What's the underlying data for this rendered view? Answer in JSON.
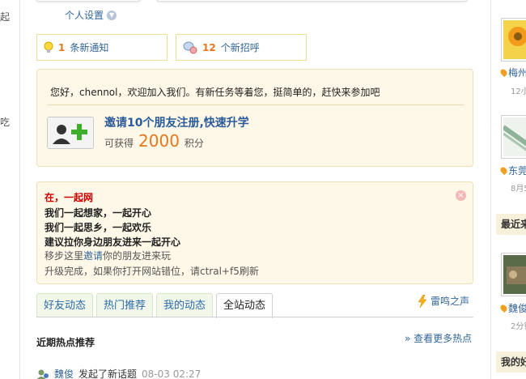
{
  "left_sidebar": {
    "chars": [
      "起",
      "吃"
    ]
  },
  "header": {
    "personal_settings": "个人设置"
  },
  "notifications": {
    "notice": {
      "count": "1",
      "label": "条新通知"
    },
    "greeting": {
      "count": "12",
      "label": "个新招呼"
    }
  },
  "welcome": {
    "message": "您好，chennol，欢迎加入我们。有新任务等着您，挺简单的，赶快来参加吧",
    "invite_title": "邀请10个朋友注册,快速升学",
    "reward_prefix": "可获得",
    "reward_points": "2000",
    "reward_suffix": "积分"
  },
  "notice": {
    "title": "在，一起网",
    "line1": "我们一起想家，一起开心",
    "line2": "我们一起思乡，一起欢乐",
    "line3": "建议拉你身边朋友进来一起开心",
    "line4_prefix": "移步这里",
    "line4_link": "邀请",
    "line4_suffix": "你的朋友进来玩",
    "line5": "升级完成，如果你打开网站错位，请ctral+f5刷新"
  },
  "tabs": [
    {
      "label": "好友动态",
      "active": false
    },
    {
      "label": "热门推荐",
      "active": false
    },
    {
      "label": "我的动态",
      "active": false
    },
    {
      "label": "全站动态",
      "active": true
    }
  ],
  "thunder": {
    "label": "雷鸣之声"
  },
  "hot": {
    "title": "近期热点推荐",
    "more": "» 查看更多热点"
  },
  "feed": {
    "user": "魏俊",
    "action": "发起了新话题",
    "time": "08-03 02:27"
  },
  "right_sidebar": {
    "items": [
      {
        "label": "梅州",
        "meta": "12小"
      },
      {
        "label": "东莞",
        "meta": "8月5"
      },
      {
        "label": "魏俊",
        "meta": "2分钟"
      }
    ],
    "section1": "最近来",
    "section2": "我的好"
  },
  "colors": {
    "accent_orange": "#e7771b",
    "link_blue": "#336699",
    "panel_bg": "#fdf8e7",
    "tab_bg": "#f1f8ea"
  }
}
